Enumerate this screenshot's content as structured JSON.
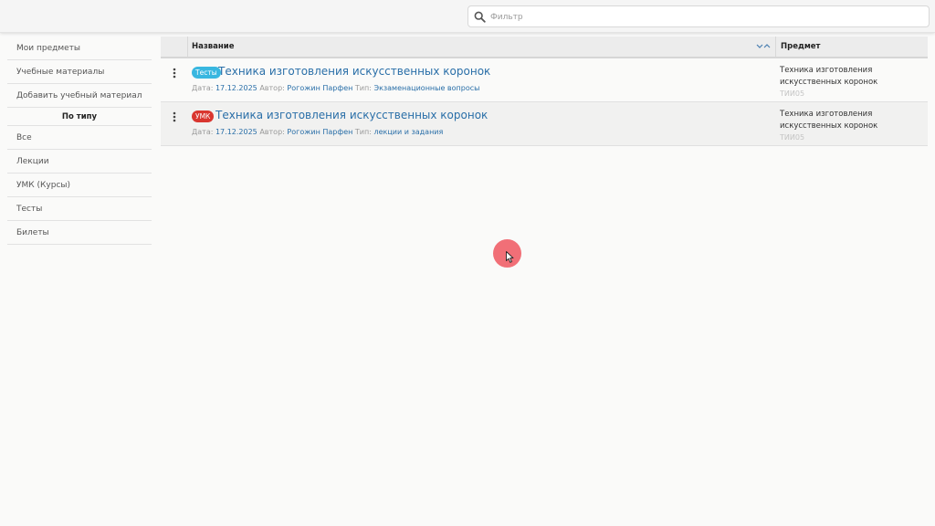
{
  "search": {
    "placeholder": "Фильтр",
    "value": ""
  },
  "sidebar": {
    "items": [
      {
        "label": "Мои предметы"
      },
      {
        "label": "Учебные материалы"
      },
      {
        "label": "Добавить учебный материал"
      }
    ],
    "section_title": "По типу",
    "type_items": [
      {
        "label": "Все"
      },
      {
        "label": "Лекции"
      },
      {
        "label": "УМК (Курсы)"
      },
      {
        "label": "Тесты"
      },
      {
        "label": "Билеты"
      }
    ]
  },
  "table": {
    "headers": {
      "name": "Название",
      "subject": "Предмет"
    },
    "rows": [
      {
        "badge": "Тесты",
        "badge_color": "#39b7e0",
        "title": "Техника изготовления искусственных коронок",
        "date_label": "Дата:",
        "date": "17.12.2025",
        "author_label": "Автор:",
        "author": "Рогожин Парфен",
        "type_label": "Тип:",
        "type": "Экзаменационные вопросы",
        "subject": "Техника изготовления искусственных коронок",
        "subject_code": "ТИИ05"
      },
      {
        "badge": "УМК",
        "badge_color": "#d9362f",
        "title": "Техника изготовления искусственных коронок",
        "date_label": "Дата:",
        "date": "17.12.2025",
        "author_label": "Автор:",
        "author": "Рогожин Парфен",
        "type_label": "Тип:",
        "type": "лекции и задания",
        "subject": "Техника изготовления искусственных коронок",
        "subject_code": "ТИИ05"
      }
    ]
  },
  "colors": {
    "link": "#2a6fa8",
    "badge_tests": "#39b7e0",
    "badge_umk": "#d9362f",
    "cursor_highlight": "#ee4852"
  }
}
